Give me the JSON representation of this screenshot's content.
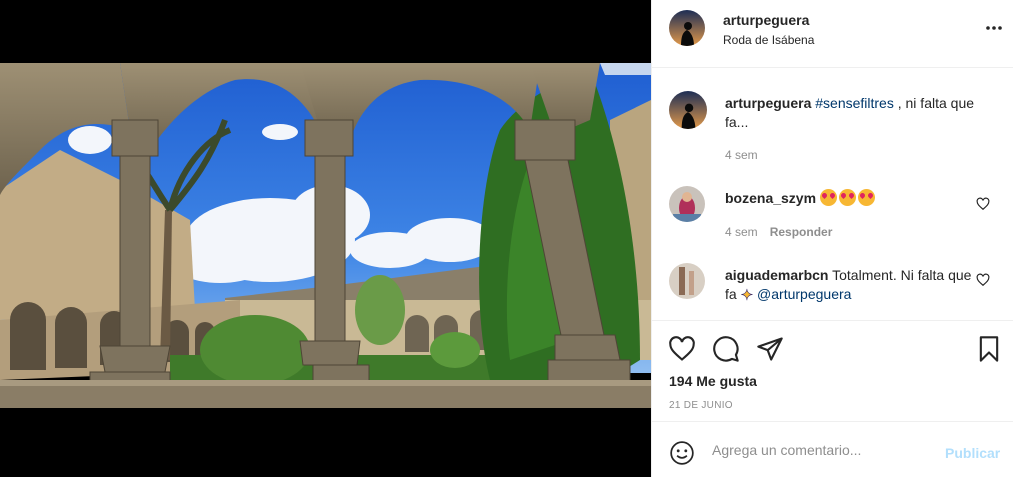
{
  "post": {
    "author": {
      "username": "arturpeguera",
      "location": "Roda de Isábena"
    },
    "photo_subject": "cloister",
    "caption": {
      "username": "arturpeguera",
      "hashtag": "#sensefiltres",
      "text": ", ni falta que fa...",
      "time": "4 sem"
    },
    "comments": [
      {
        "username": "bozena_szym",
        "emoji_count": 3,
        "time": "4 sem",
        "reply_label": "Responder"
      },
      {
        "username": "aiguademarbcn",
        "text": "Totalment. Ni falta que fa",
        "mention": "@arturpeguera"
      }
    ],
    "likes": "194 Me gusta",
    "date": "21 DE JUNIO",
    "add_comment": {
      "placeholder": "Agrega un comentario...",
      "publish_label": "Publicar"
    }
  },
  "icons": {
    "more": "more-options-icon",
    "like": "heart-icon",
    "comment": "comment-icon",
    "share": "paper-plane-icon",
    "save": "bookmark-icon",
    "emoji": "smiley-icon"
  },
  "colors": {
    "link": "#00376b",
    "muted": "#8e8e8e",
    "publish_disabled": "#b2dffc",
    "text": "#262626"
  }
}
